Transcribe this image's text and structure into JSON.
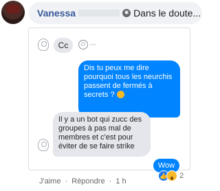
{
  "comment": {
    "author": "Vanessa",
    "header_text": "Dans le doute..."
  },
  "chat": {
    "first_message": "Cc",
    "outgoing_message": "Dis tu peux me dire pourquoi tous les neurchis passent de fermés à secrets ?",
    "incoming_message": "Il y a un bot qui zucc des groupes à pas mal de membres et c'est pour éviter de se faire strike",
    "last_message": "Wow"
  },
  "actions": {
    "like": "J'aime",
    "reply": "Répondre",
    "time": "1 h"
  },
  "reactions": {
    "count": "2",
    "types": [
      "like-icon",
      "wow-icon"
    ]
  },
  "colors": {
    "messenger_blue": "#0084ff",
    "bubble_gray": "#e4e6eb",
    "author_blue": "#385898",
    "emoji_yellow": "#f7b928"
  }
}
